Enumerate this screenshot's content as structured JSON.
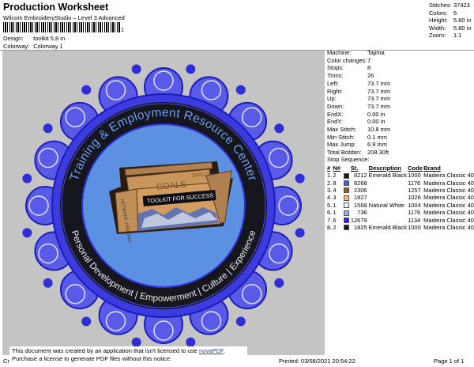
{
  "header": {
    "title": "Production Worksheet",
    "subtitle": "Wilcom EmbroideryStudio – Level 3 Advanced",
    "barcode_suffix": "1",
    "design_label": "Design:",
    "design_value": "toolkit 5,8 in",
    "colorway_label": "Colorway:",
    "colorway_value": "Colorway 1"
  },
  "stats": [
    {
      "label": "Stitches:",
      "value": "37423"
    },
    {
      "label": "Colors:",
      "value": "6"
    },
    {
      "label": "Height:",
      "value": "5.80 in"
    },
    {
      "label": "Width:",
      "value": "5.80 in"
    },
    {
      "label": "Zoom:",
      "value": "1:1"
    }
  ],
  "machine_info": [
    {
      "label": "Machine:",
      "value": "Tajima"
    },
    {
      "label": "Color changes:",
      "value": "7"
    },
    {
      "label": "Stops:",
      "value": "8"
    },
    {
      "label": "Trims:",
      "value": "26"
    },
    {
      "label": "Left:",
      "value": "73.7 mm"
    },
    {
      "label": "Right:",
      "value": "73.7 mm"
    },
    {
      "label": "Up:",
      "value": "73.7 mm"
    },
    {
      "label": "Down:",
      "value": "73.7 mm"
    },
    {
      "label": "EndX:",
      "value": "0.00 in"
    },
    {
      "label": "EndY:",
      "value": "0.00 in"
    },
    {
      "label": "Max Stitch:",
      "value": "10.8 mm"
    },
    {
      "label": "Min Stitch:",
      "value": "0.1 mm"
    },
    {
      "label": "Max Jump:",
      "value": "6.9 mm"
    },
    {
      "label": "Total Bobbin:",
      "value": "208.30ft"
    }
  ],
  "stop_sequence": {
    "title": "Stop Sequence:",
    "headers": [
      "#",
      "N#",
      "St.",
      "Description",
      "Code",
      "Brand"
    ],
    "rows": [
      {
        "num": "1.",
        "n": "2",
        "color": "#161616",
        "st": "8212",
        "desc": "Emerald Black",
        "code": "1000",
        "brand": "Madeira Classic 40"
      },
      {
        "num": "2.",
        "n": "8",
        "color": "#3f62d6",
        "st": "8268",
        "desc": "",
        "code": "1176",
        "brand": "Madeira Classic 40"
      },
      {
        "num": "3.",
        "n": "4",
        "color": "#8c5a34",
        "st": "2306",
        "desc": "",
        "code": "1257",
        "brand": "Madeira Classic 40"
      },
      {
        "num": "4.",
        "n": "3",
        "color": "#f0be96",
        "st": "1827",
        "desc": "",
        "code": "1026",
        "brand": "Madeira Classic 40"
      },
      {
        "num": "5.",
        "n": "1",
        "color": "#f4f4f4",
        "st": "1568",
        "desc": "Natural White",
        "code": "1004",
        "brand": "Madeira Classic 40"
      },
      {
        "num": "6.",
        "n": "1",
        "color": "#8fb3ea",
        "st": "736",
        "desc": "",
        "code": "1176",
        "brand": "Madeira Classic 40"
      },
      {
        "num": "7.",
        "n": "6",
        "color": "#3a1fc8",
        "st": "12679",
        "desc": "",
        "code": "1134",
        "brand": "Madeira Classic 40"
      },
      {
        "num": "8.",
        "n": "2",
        "color": "#161616",
        "st": "1825",
        "desc": "Emerald Black",
        "code": "1000",
        "brand": "Madeira Classic 40"
      }
    ]
  },
  "design_text": {
    "arc_top": "Training & Employment Resource Center",
    "arc_bottom": "Personal Development | Empowerment | Culture | Experience",
    "goals": "GOALS",
    "skills": "SKILLS",
    "network": "NETWORK TRAINING",
    "toolkit": "TOOLKIT FOR SUCCESS"
  },
  "colors": {
    "lace": "#2f2fd8",
    "ring": "#12121a",
    "inner": "#5c90e0",
    "wood": "#c8955c",
    "wood_dark": "#8c5a34",
    "canvas": "#c4c4c4"
  },
  "footer": {
    "notice_line1_prefix": "This document was created by an application that isn't licensed to use",
    "notice_link": "novaPDF",
    "notice_line1_suffix": ".",
    "notice_line2": "Purchase a license to generate PDF files without this notice.",
    "cr_text": "Cr",
    "printed": "Printed: 03/08/2021 20:54:22",
    "page": "Page 1 of 1"
  }
}
